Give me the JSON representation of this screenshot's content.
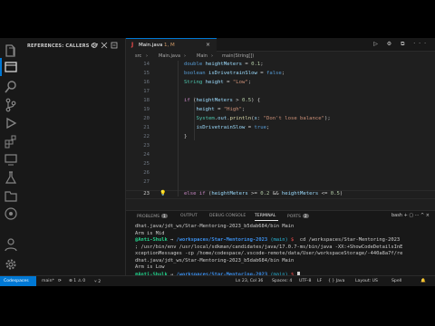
{
  "sidebar": {
    "title": "REFERENCES: CALLERS OF"
  },
  "editor": {
    "tab_label": "Main.java",
    "tab_modified": "1, M",
    "tab_close": "×",
    "actions": "▷ ⚙ ⧉ ···",
    "breadcrumb": [
      "src",
      "Main.java",
      "Main",
      "main(String[])"
    ],
    "line_numbers": [
      "14",
      "15",
      "16",
      "17",
      "18",
      "19",
      "20",
      "21",
      "22",
      "23",
      "24",
      "25",
      "26",
      "27",
      "28"
    ],
    "current_line": "23"
  },
  "panel": {
    "tabs": [
      "PROBLEMS",
      "OUTPUT",
      "DEBUG CONSOLE",
      "TERMINAL",
      "PORTS"
    ],
    "problems_count": "1",
    "ports_count": "2",
    "active_tab": "TERMINAL",
    "actions": "bash  +  ▢  ···  ^  ×"
  },
  "terminal": {
    "line1": "dhat.java/jdt_ws/Star-Mentoring-2023_b5dab684/bin Main",
    "line2": "Arm is Mid",
    "prompt_user": "@Anti-Shulk",
    "prompt_path": "/workspaces/Star-Mentoring-2023",
    "prompt_branch": "(main)",
    "cmd": "cd /workspaces/Star-Mentoring-2023",
    "cmd2": "; /usr/bin/env /usr/local/sdkman/candidates/java/17.0.7-ms/bin/java -XX:+ShowCodeDetailsInE",
    "cmd3": "xceptionMessages -cp /home/codespace/.vscode-remote/data/User/workspaceStorage/-440a8a7f/re",
    "line6": "dhat.java/jdt_ws/Star-Mentoring-2023_b5dab684/bin Main",
    "line7": "Arm is Low"
  },
  "status": {
    "remote": "Codespaces",
    "branch": "main*",
    "sync": "⟳",
    "errors": "⊗ 1  ⚠ 0",
    "ports": "⑂ 2",
    "position": "Ln 23, Col 36",
    "spaces": "Spaces: 4",
    "encoding": "UTF-8",
    "eol": "LF",
    "language": "{ } Java",
    "layout": "Layout: US",
    "spell": "Spell"
  },
  "colors": {
    "accent": "#0078d4",
    "editor_bg": "#1f1f1f",
    "sidebar_bg": "#181818"
  },
  "icons": [
    "explorer-icon",
    "search-icon",
    "source-control-icon",
    "run-debug-icon",
    "extensions-icon",
    "remote-explorer-icon",
    "testing-icon",
    "java-projects-icon",
    "accounts-icon",
    "settings-icon"
  ]
}
